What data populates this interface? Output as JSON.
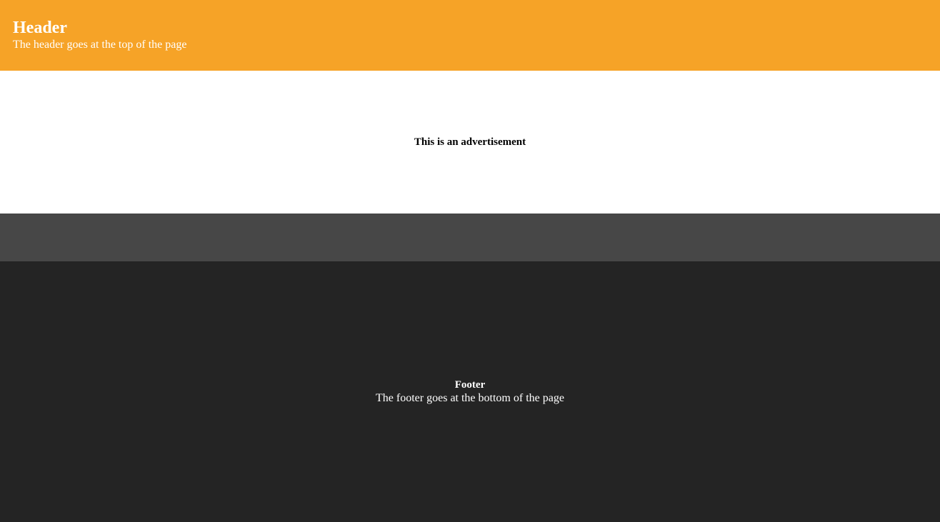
{
  "header": {
    "title": "Header",
    "subtitle": "The header goes at the top of the page",
    "background": "#f6a327"
  },
  "advertisement": {
    "text": "This is an advertisement",
    "background": "#ffffff"
  },
  "nav_band": {
    "background": "#474747"
  },
  "footer": {
    "title": "Footer",
    "subtitle": "The footer goes at the bottom of the page",
    "background": "#242424"
  }
}
